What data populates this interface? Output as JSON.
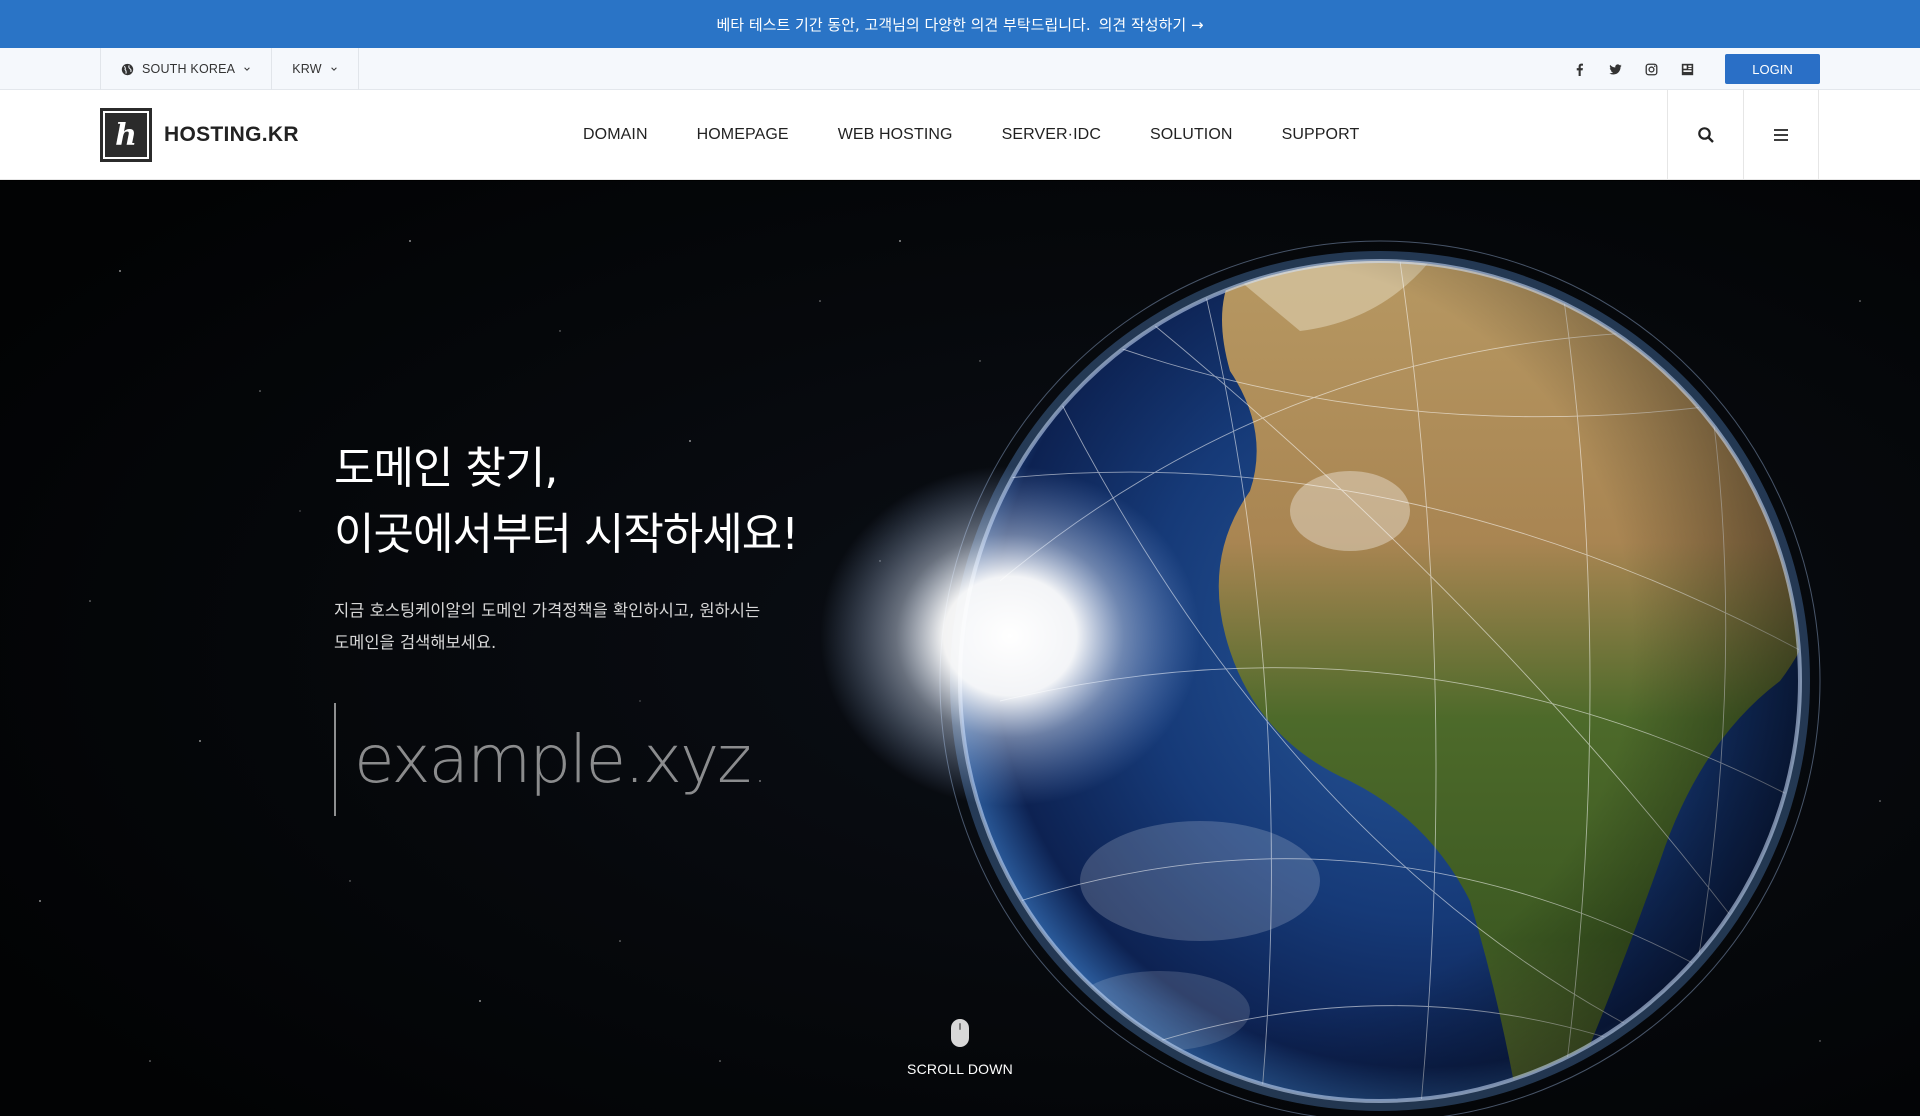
{
  "announcement": {
    "text": "베타 테스트 기간 동안, 고객님의 다양한 의견 부탁드립니다.",
    "link": "의견 작성하기 →"
  },
  "utility": {
    "country": "SOUTH KOREA",
    "currency": "KRW",
    "social": [
      "facebook-icon",
      "twitter-icon",
      "instagram-icon",
      "blog-icon"
    ],
    "login_label": "LOGIN"
  },
  "nav": {
    "brand": "HOSTING.KR",
    "logo_letter": "h",
    "items": [
      "DOMAIN",
      "HOMEPAGE",
      "WEB HOSTING",
      "SERVER·IDC",
      "SOLUTION",
      "SUPPORT"
    ],
    "icons": [
      "search-icon",
      "menu-icon"
    ]
  },
  "hero": {
    "title_line1": "도메인 찾기,",
    "title_line2": "이곳에서부터 시작하세요!",
    "desc_line1": "지금 호스팅케이알의 도메인 가격정책을 확인하시고, 원하시는",
    "desc_line2": "도메인을 검색해보세요.",
    "search_placeholder": "example.xyz",
    "scroll_label": "SCROLL DOWN"
  },
  "colors": {
    "accent": "#2a74c6",
    "login": "#2a6fc6",
    "hero_bg": "#030508"
  }
}
